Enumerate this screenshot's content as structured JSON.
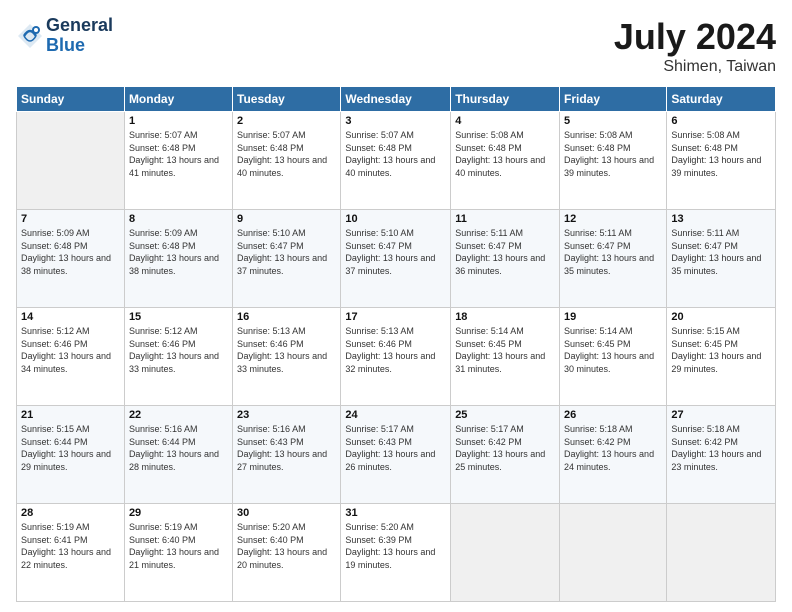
{
  "header": {
    "logo_line1": "General",
    "logo_line2": "Blue",
    "month": "July 2024",
    "location": "Shimen, Taiwan"
  },
  "columns": [
    "Sunday",
    "Monday",
    "Tuesday",
    "Wednesday",
    "Thursday",
    "Friday",
    "Saturday"
  ],
  "weeks": [
    [
      {
        "day": "",
        "sunrise": "",
        "sunset": "",
        "daylight": ""
      },
      {
        "day": "1",
        "sunrise": "5:07 AM",
        "sunset": "6:48 PM",
        "daylight": "13 hours and 41 minutes."
      },
      {
        "day": "2",
        "sunrise": "5:07 AM",
        "sunset": "6:48 PM",
        "daylight": "13 hours and 40 minutes."
      },
      {
        "day": "3",
        "sunrise": "5:07 AM",
        "sunset": "6:48 PM",
        "daylight": "13 hours and 40 minutes."
      },
      {
        "day": "4",
        "sunrise": "5:08 AM",
        "sunset": "6:48 PM",
        "daylight": "13 hours and 40 minutes."
      },
      {
        "day": "5",
        "sunrise": "5:08 AM",
        "sunset": "6:48 PM",
        "daylight": "13 hours and 39 minutes."
      },
      {
        "day": "6",
        "sunrise": "5:08 AM",
        "sunset": "6:48 PM",
        "daylight": "13 hours and 39 minutes."
      }
    ],
    [
      {
        "day": "7",
        "sunrise": "5:09 AM",
        "sunset": "6:48 PM",
        "daylight": "13 hours and 38 minutes."
      },
      {
        "day": "8",
        "sunrise": "5:09 AM",
        "sunset": "6:48 PM",
        "daylight": "13 hours and 38 minutes."
      },
      {
        "day": "9",
        "sunrise": "5:10 AM",
        "sunset": "6:47 PM",
        "daylight": "13 hours and 37 minutes."
      },
      {
        "day": "10",
        "sunrise": "5:10 AM",
        "sunset": "6:47 PM",
        "daylight": "13 hours and 37 minutes."
      },
      {
        "day": "11",
        "sunrise": "5:11 AM",
        "sunset": "6:47 PM",
        "daylight": "13 hours and 36 minutes."
      },
      {
        "day": "12",
        "sunrise": "5:11 AM",
        "sunset": "6:47 PM",
        "daylight": "13 hours and 35 minutes."
      },
      {
        "day": "13",
        "sunrise": "5:11 AM",
        "sunset": "6:47 PM",
        "daylight": "13 hours and 35 minutes."
      }
    ],
    [
      {
        "day": "14",
        "sunrise": "5:12 AM",
        "sunset": "6:46 PM",
        "daylight": "13 hours and 34 minutes."
      },
      {
        "day": "15",
        "sunrise": "5:12 AM",
        "sunset": "6:46 PM",
        "daylight": "13 hours and 33 minutes."
      },
      {
        "day": "16",
        "sunrise": "5:13 AM",
        "sunset": "6:46 PM",
        "daylight": "13 hours and 33 minutes."
      },
      {
        "day": "17",
        "sunrise": "5:13 AM",
        "sunset": "6:46 PM",
        "daylight": "13 hours and 32 minutes."
      },
      {
        "day": "18",
        "sunrise": "5:14 AM",
        "sunset": "6:45 PM",
        "daylight": "13 hours and 31 minutes."
      },
      {
        "day": "19",
        "sunrise": "5:14 AM",
        "sunset": "6:45 PM",
        "daylight": "13 hours and 30 minutes."
      },
      {
        "day": "20",
        "sunrise": "5:15 AM",
        "sunset": "6:45 PM",
        "daylight": "13 hours and 29 minutes."
      }
    ],
    [
      {
        "day": "21",
        "sunrise": "5:15 AM",
        "sunset": "6:44 PM",
        "daylight": "13 hours and 29 minutes."
      },
      {
        "day": "22",
        "sunrise": "5:16 AM",
        "sunset": "6:44 PM",
        "daylight": "13 hours and 28 minutes."
      },
      {
        "day": "23",
        "sunrise": "5:16 AM",
        "sunset": "6:43 PM",
        "daylight": "13 hours and 27 minutes."
      },
      {
        "day": "24",
        "sunrise": "5:17 AM",
        "sunset": "6:43 PM",
        "daylight": "13 hours and 26 minutes."
      },
      {
        "day": "25",
        "sunrise": "5:17 AM",
        "sunset": "6:42 PM",
        "daylight": "13 hours and 25 minutes."
      },
      {
        "day": "26",
        "sunrise": "5:18 AM",
        "sunset": "6:42 PM",
        "daylight": "13 hours and 24 minutes."
      },
      {
        "day": "27",
        "sunrise": "5:18 AM",
        "sunset": "6:42 PM",
        "daylight": "13 hours and 23 minutes."
      }
    ],
    [
      {
        "day": "28",
        "sunrise": "5:19 AM",
        "sunset": "6:41 PM",
        "daylight": "13 hours and 22 minutes."
      },
      {
        "day": "29",
        "sunrise": "5:19 AM",
        "sunset": "6:40 PM",
        "daylight": "13 hours and 21 minutes."
      },
      {
        "day": "30",
        "sunrise": "5:20 AM",
        "sunset": "6:40 PM",
        "daylight": "13 hours and 20 minutes."
      },
      {
        "day": "31",
        "sunrise": "5:20 AM",
        "sunset": "6:39 PM",
        "daylight": "13 hours and 19 minutes."
      },
      {
        "day": "",
        "sunrise": "",
        "sunset": "",
        "daylight": ""
      },
      {
        "day": "",
        "sunrise": "",
        "sunset": "",
        "daylight": ""
      },
      {
        "day": "",
        "sunrise": "",
        "sunset": "",
        "daylight": ""
      }
    ]
  ]
}
